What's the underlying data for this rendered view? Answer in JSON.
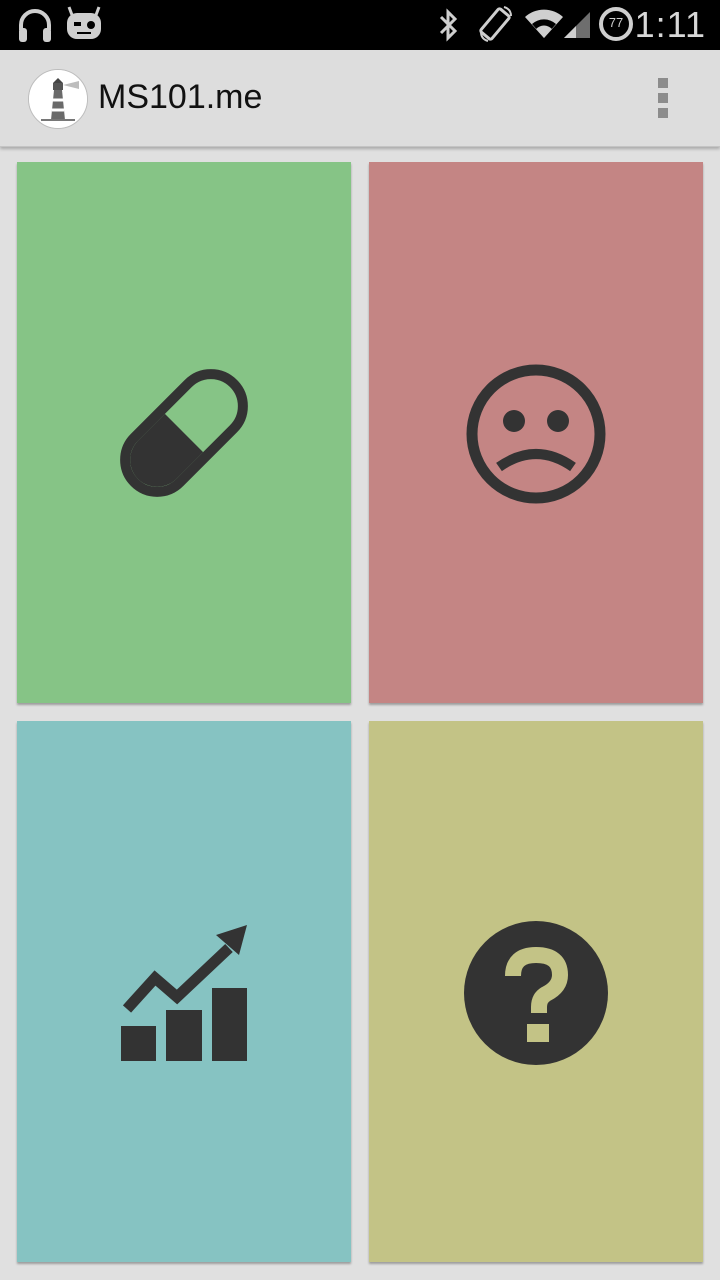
{
  "status_bar": {
    "time": "1:11",
    "battery_level": "77",
    "icons": [
      "headphones-icon",
      "cyanogen-bot-icon",
      "bluetooth-icon",
      "screen-rotate-icon",
      "wifi-icon",
      "cell-signal-icon",
      "battery-icon"
    ]
  },
  "action_bar": {
    "title": "MS101.me",
    "logo_icon": "lighthouse-icon",
    "menu_icon": "overflow-menu-icon"
  },
  "tiles": [
    {
      "icon": "pill-icon",
      "color": "#86c486"
    },
    {
      "icon": "sad-face-icon",
      "color": "#c48584"
    },
    {
      "icon": "chart-growth-icon",
      "color": "#86c3c2"
    },
    {
      "icon": "question-mark-icon",
      "color": "#c3c386"
    }
  ],
  "colors": {
    "icon_fill": "#333333",
    "background": "#e0e0e0",
    "action_bar": "#dddddd"
  }
}
